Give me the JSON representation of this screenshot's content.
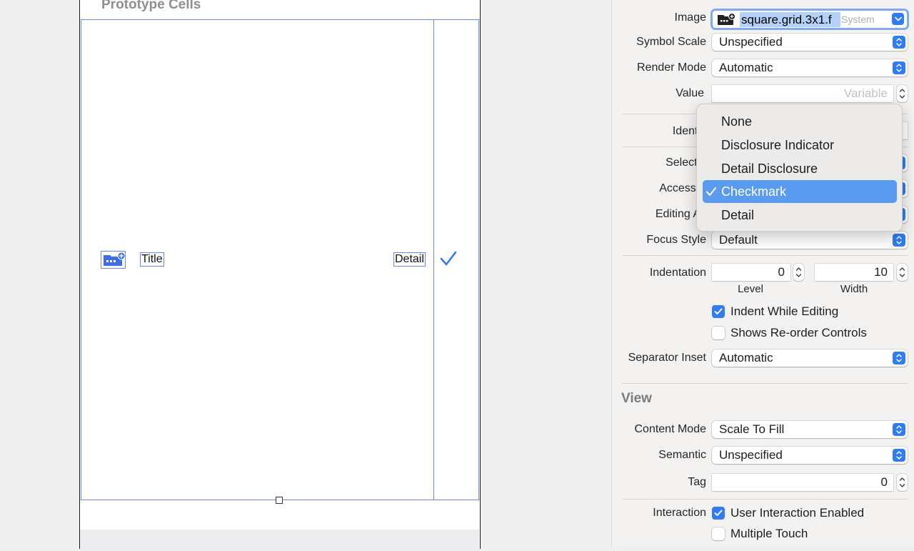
{
  "canvas": {
    "prototype_cells_title": "Prototype Cells",
    "cell": {
      "title": "Title",
      "detail": "Detail"
    }
  },
  "inspector": {
    "image": {
      "label": "Image",
      "value": "square.grid.3x1.f",
      "tag": "System"
    },
    "symbol_scale": {
      "label": "Symbol Scale",
      "value": "Unspecified"
    },
    "render_mode": {
      "label": "Render Mode",
      "value": "Automatic"
    },
    "value": {
      "label": "Value",
      "placeholder": "Variable"
    },
    "identifier": {
      "label": "Identifi"
    },
    "selection": {
      "label": "Selectio"
    },
    "accessory": {
      "label": "Accessor"
    },
    "editing_accessory": {
      "label": "Editing Ac"
    },
    "focus_style": {
      "label": "Focus Style",
      "value": "Default"
    },
    "indentation": {
      "label": "Indentation",
      "level": {
        "value": "0",
        "label": "Level"
      },
      "width": {
        "value": "10",
        "label": "Width"
      }
    },
    "indent_while_editing": {
      "label": "Indent While Editing",
      "checked": true
    },
    "shows_reorder_controls": {
      "label": "Shows Re-order Controls",
      "checked": false
    },
    "separator_inset": {
      "label": "Separator Inset",
      "value": "Automatic"
    },
    "view_section": {
      "title": "View"
    },
    "content_mode": {
      "label": "Content Mode",
      "value": "Scale To Fill"
    },
    "semantic": {
      "label": "Semantic",
      "value": "Unspecified"
    },
    "tag": {
      "label": "Tag",
      "value": "0"
    },
    "interaction": {
      "label": "Interaction",
      "user_interaction_enabled": {
        "label": "User Interaction Enabled",
        "checked": true
      },
      "multiple_touch": {
        "label": "Multiple Touch",
        "checked": false
      }
    }
  },
  "accessory_menu": {
    "items": [
      "None",
      "Disclosure Indicator",
      "Detail Disclosure",
      "Checkmark",
      "Detail"
    ],
    "selected": "Checkmark"
  },
  "colors": {
    "accent": "#2f7cf6",
    "selection_outline": "#6f86e8",
    "menu_highlight": "#5a9bf0"
  }
}
